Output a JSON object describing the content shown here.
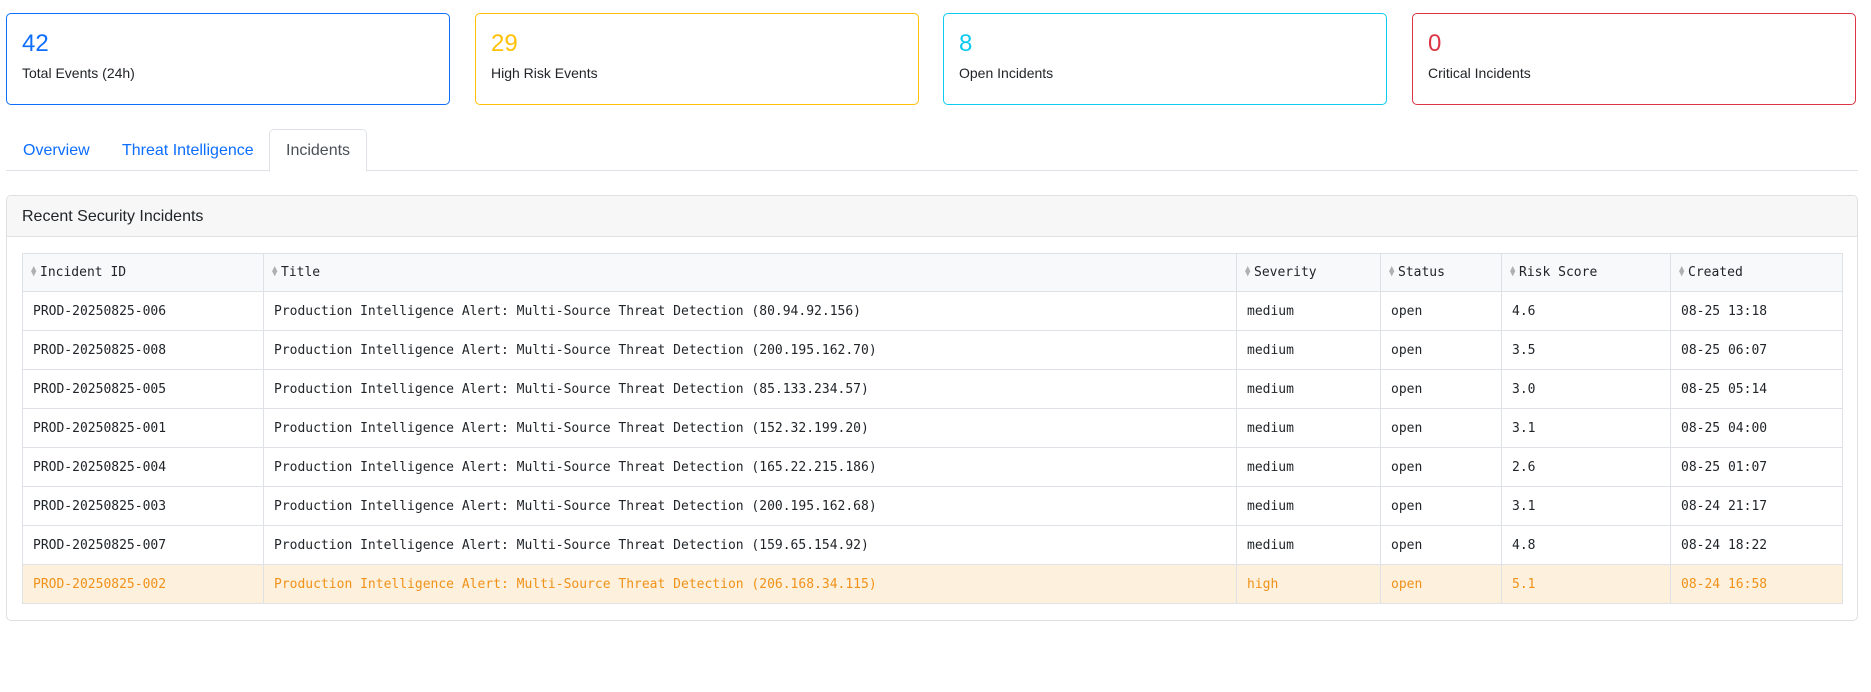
{
  "stats": [
    {
      "value": "42",
      "label": "Total Events (24h)",
      "color": "#0d6efd"
    },
    {
      "value": "29",
      "label": "High Risk Events",
      "color": "#ffc107"
    },
    {
      "value": "8",
      "label": "Open Incidents",
      "color": "#0dcaf0"
    },
    {
      "value": "0",
      "label": "Critical Incidents",
      "color": "#dc3545"
    }
  ],
  "tabs": [
    {
      "label": "Overview",
      "active": false
    },
    {
      "label": "Threat Intelligence",
      "active": false
    },
    {
      "label": "Incidents",
      "active": true
    }
  ],
  "panel": {
    "title": "Recent Security Incidents"
  },
  "table": {
    "sort_icon": "sort-icon",
    "columns": [
      "Incident ID",
      "Title",
      "Severity",
      "Status",
      "Risk Score",
      "Created"
    ],
    "rows": [
      {
        "id": "PROD-20250825-006",
        "title": "Production Intelligence Alert: Multi-Source Threat Detection (80.94.92.156)",
        "severity": "medium",
        "status": "open",
        "risk": "4.6",
        "created": "08-25 13:18"
      },
      {
        "id": "PROD-20250825-008",
        "title": "Production Intelligence Alert: Multi-Source Threat Detection (200.195.162.70)",
        "severity": "medium",
        "status": "open",
        "risk": "3.5",
        "created": "08-25 06:07"
      },
      {
        "id": "PROD-20250825-005",
        "title": "Production Intelligence Alert: Multi-Source Threat Detection (85.133.234.57)",
        "severity": "medium",
        "status": "open",
        "risk": "3.0",
        "created": "08-25 05:14"
      },
      {
        "id": "PROD-20250825-001",
        "title": "Production Intelligence Alert: Multi-Source Threat Detection (152.32.199.20)",
        "severity": "medium",
        "status": "open",
        "risk": "3.1",
        "created": "08-25 04:00"
      },
      {
        "id": "PROD-20250825-004",
        "title": "Production Intelligence Alert: Multi-Source Threat Detection (165.22.215.186)",
        "severity": "medium",
        "status": "open",
        "risk": "2.6",
        "created": "08-25 01:07"
      },
      {
        "id": "PROD-20250825-003",
        "title": "Production Intelligence Alert: Multi-Source Threat Detection (200.195.162.68)",
        "severity": "medium",
        "status": "open",
        "risk": "3.1",
        "created": "08-24 21:17"
      },
      {
        "id": "PROD-20250825-007",
        "title": "Production Intelligence Alert: Multi-Source Threat Detection (159.65.154.92)",
        "severity": "medium",
        "status": "open",
        "risk": "4.8",
        "created": "08-24 18:22"
      },
      {
        "id": "PROD-20250825-002",
        "title": "Production Intelligence Alert: Multi-Source Threat Detection (206.168.34.115)",
        "severity": "high",
        "status": "open",
        "risk": "5.1",
        "created": "08-24 16:58"
      }
    ],
    "highlight_color": "#f0921a",
    "highlight_bg": "#fdf0dc"
  }
}
